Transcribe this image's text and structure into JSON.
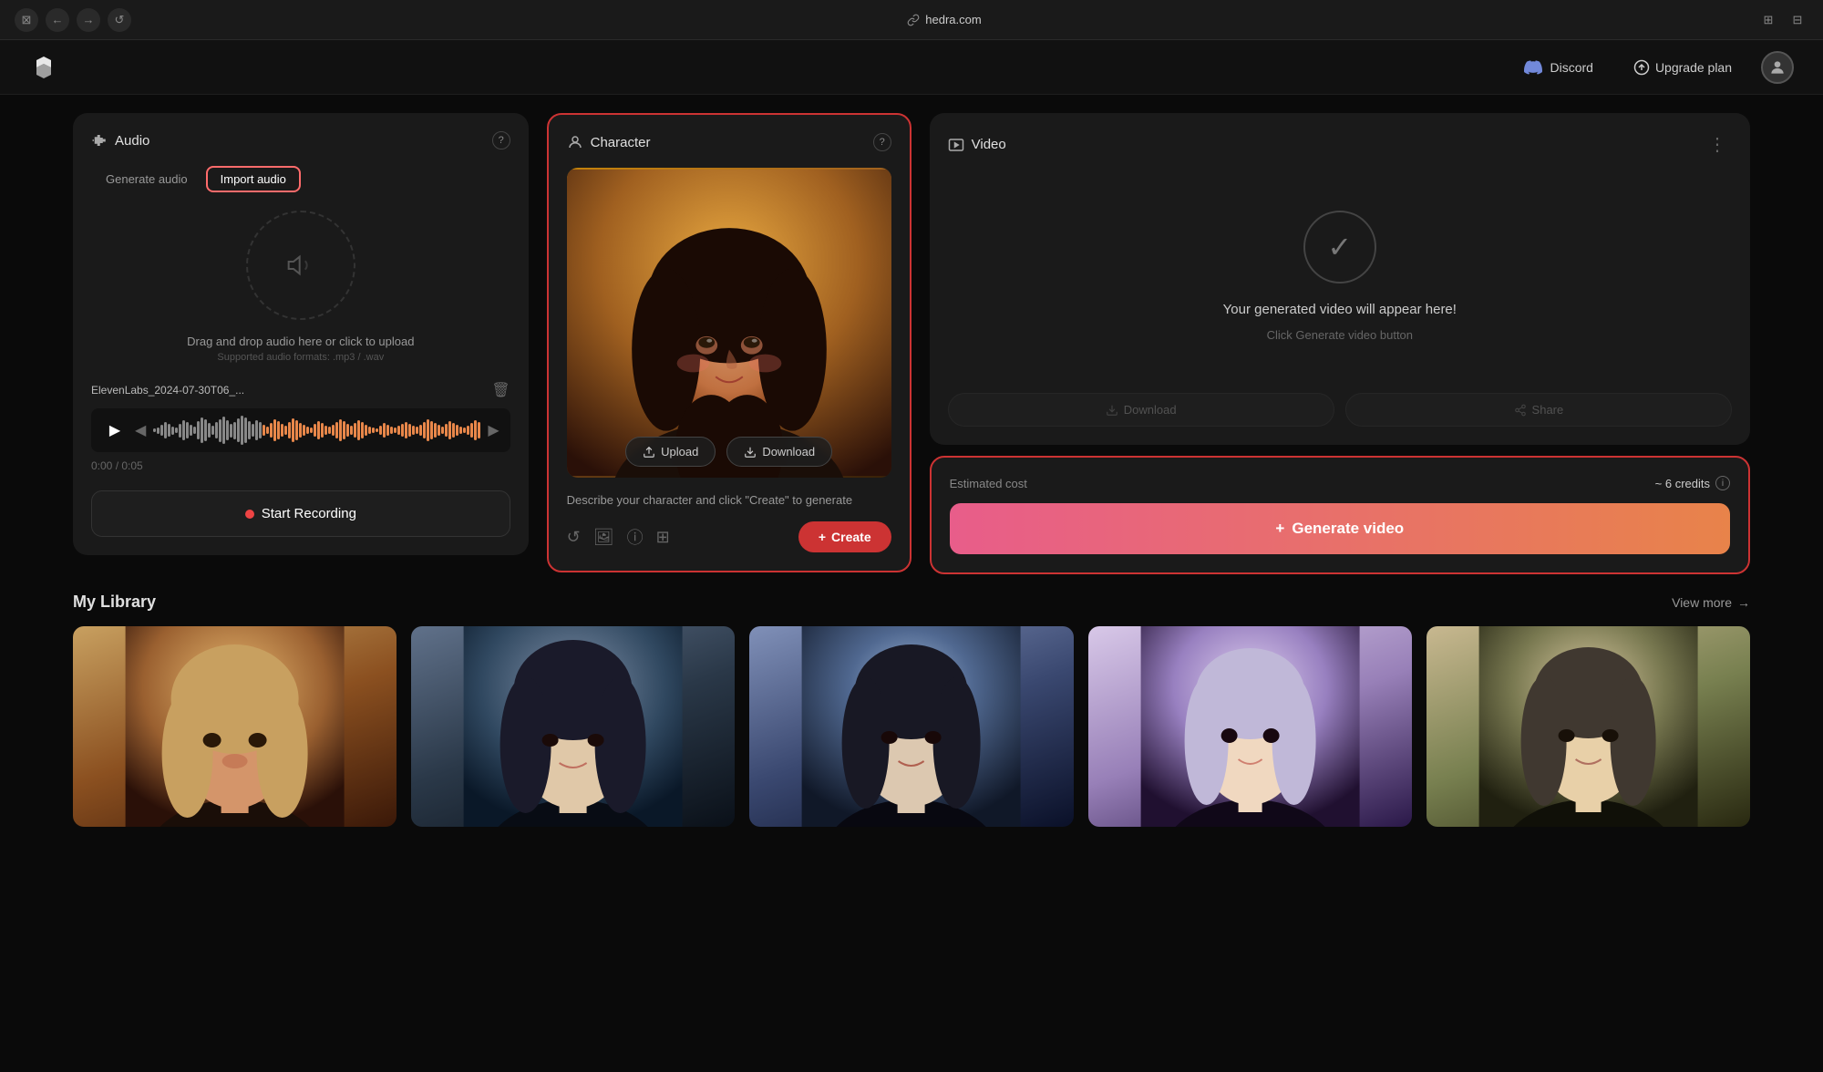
{
  "browser": {
    "url": "hedra.com",
    "nav_back": "←",
    "nav_forward": "→",
    "nav_reload": "↺",
    "nav_tab": "⊡"
  },
  "header": {
    "logo_alt": "Hedra Logo",
    "discord_label": "Discord",
    "upgrade_label": "Upgrade plan",
    "avatar_icon": "👤"
  },
  "audio_panel": {
    "title": "Audio",
    "help_icon": "?",
    "tab_generate": "Generate audio",
    "tab_import": "Import audio",
    "upload_icon": "🔊",
    "drag_text": "Drag and drop audio here or click to upload",
    "supported_text": "Supported audio formats: .mp3 / .wav",
    "filename": "ElevenLabs_2024-07-30T06_...",
    "time_current": "0:00",
    "time_total": "0:05",
    "time_display": "0:00 / 0:05",
    "play_icon": "▶",
    "start_recording_label": "Start Recording",
    "record_icon": "●"
  },
  "character_panel": {
    "title": "Character",
    "help_icon": "?",
    "upload_btn": "Upload",
    "download_btn": "Download",
    "describe_text": "Describe your character and click \"Create\" to generate",
    "create_btn": "Create",
    "plus_icon": "+"
  },
  "video_panel": {
    "title": "Video",
    "more_icon": "⋮",
    "placeholder_title": "Your generated video will appear here!",
    "placeholder_sub": "Click Generate video button",
    "check_icon": "✓",
    "download_btn": "Download",
    "share_btn": "Share",
    "estimated_cost_label": "Estimated cost",
    "estimated_cost_value": "~ 6 credits",
    "info_icon": "i",
    "generate_btn": "Generate video",
    "plus_icon": "+"
  },
  "library": {
    "title": "My Library",
    "view_more": "View more",
    "arrow": "→",
    "items": [
      {
        "id": 1,
        "color_class": "lib-1"
      },
      {
        "id": 2,
        "color_class": "lib-2"
      },
      {
        "id": 3,
        "color_class": "lib-3"
      },
      {
        "id": 4,
        "color_class": "lib-4"
      },
      {
        "id": 5,
        "color_class": "lib-5"
      }
    ]
  },
  "waveform": {
    "heights": [
      4,
      7,
      12,
      18,
      14,
      9,
      6,
      15,
      22,
      18,
      12,
      8,
      20,
      28,
      24,
      16,
      10,
      18,
      25,
      30,
      22,
      15,
      19,
      26,
      32,
      28,
      20,
      14,
      22,
      18,
      12,
      8,
      16,
      24,
      20,
      14,
      10,
      18,
      26,
      22,
      16,
      12,
      8,
      6,
      14,
      20,
      16,
      10,
      8,
      12,
      18,
      24,
      20,
      14,
      10,
      16,
      22,
      18,
      12,
      8,
      6,
      4,
      10,
      16,
      12,
      8,
      6,
      10,
      14,
      18,
      14,
      10,
      8,
      12,
      18,
      24,
      20,
      16,
      12,
      8,
      14,
      20,
      16,
      12,
      8,
      6,
      10,
      16,
      22,
      18
    ]
  }
}
